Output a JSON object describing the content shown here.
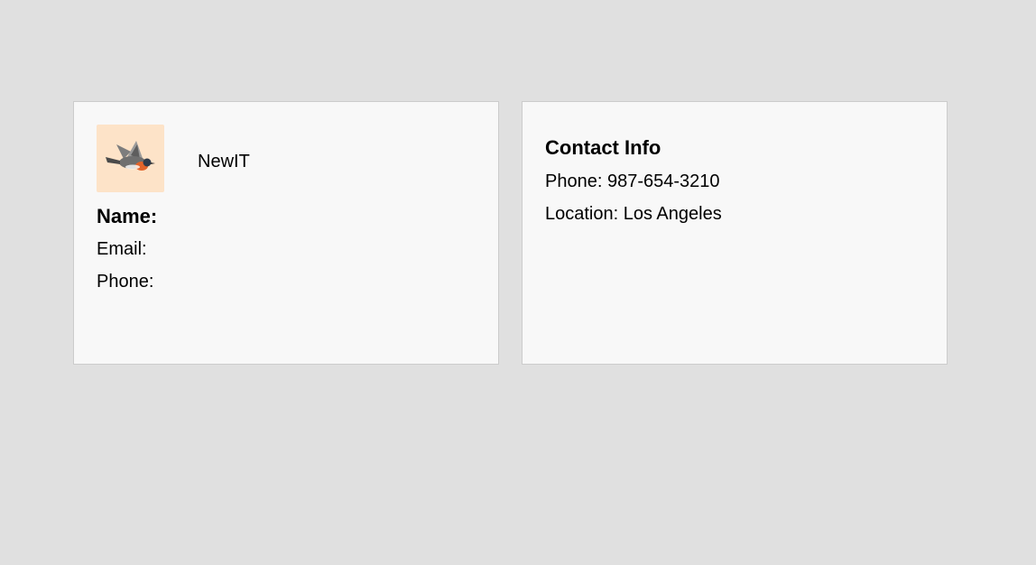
{
  "profile_card": {
    "logo_icon": "bird-logo-icon",
    "logo_bg_color": "#fde3c8",
    "company": "NewIT",
    "name_label": "Name:",
    "email_label": "Email:",
    "phone_label": "Phone:"
  },
  "contact_card": {
    "title": "Contact Info",
    "phone": "Phone: 987-654-3210",
    "location": "Location: Los Angeles"
  }
}
